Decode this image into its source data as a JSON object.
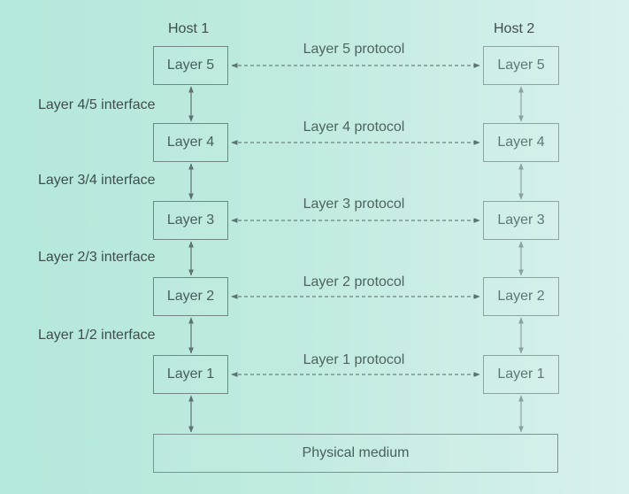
{
  "hosts": {
    "left": "Host 1",
    "right": "Host 2"
  },
  "layers": [
    {
      "left": "Layer 5",
      "right": "Layer 5",
      "protocol": "Layer 5 protocol"
    },
    {
      "left": "Layer 4",
      "right": "Layer 4",
      "protocol": "Layer 4 protocol"
    },
    {
      "left": "Layer 3",
      "right": "Layer 3",
      "protocol": "Layer 3 protocol"
    },
    {
      "left": "Layer 2",
      "right": "Layer 2",
      "protocol": "Layer 2 protocol"
    },
    {
      "left": "Layer 1",
      "right": "Layer 1",
      "protocol": "Layer 1 protocol"
    }
  ],
  "interfaces": [
    "Layer 4/5 interface",
    "Layer 3/4 interface",
    "Layer 2/3 interface",
    "Layer 1/2 interface"
  ],
  "medium": "Physical medium"
}
